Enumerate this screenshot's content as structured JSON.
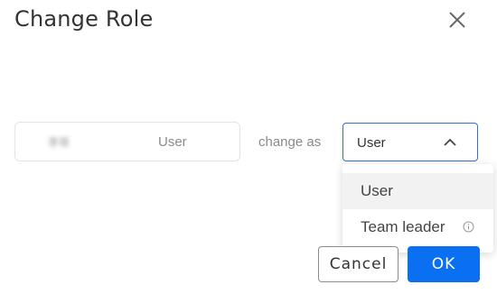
{
  "dialog": {
    "title": "Change Role",
    "close_icon": "close-icon"
  },
  "user": {
    "name": "李哥",
    "current_role": "User"
  },
  "change_as_label": "change as",
  "role_select": {
    "selected": "User",
    "state": "open",
    "chevron_icon": "chevron-up-icon",
    "options": [
      {
        "label": "User",
        "highlighted": true
      },
      {
        "label": "Team leader",
        "icon": "info-icon"
      }
    ]
  },
  "buttons": {
    "cancel_label": "Cancel",
    "ok_label": "OK"
  },
  "colors": {
    "primary": "#0b6ff2",
    "select_border": "#2f6fd6",
    "highlight_bg": "#f2f2f2"
  }
}
